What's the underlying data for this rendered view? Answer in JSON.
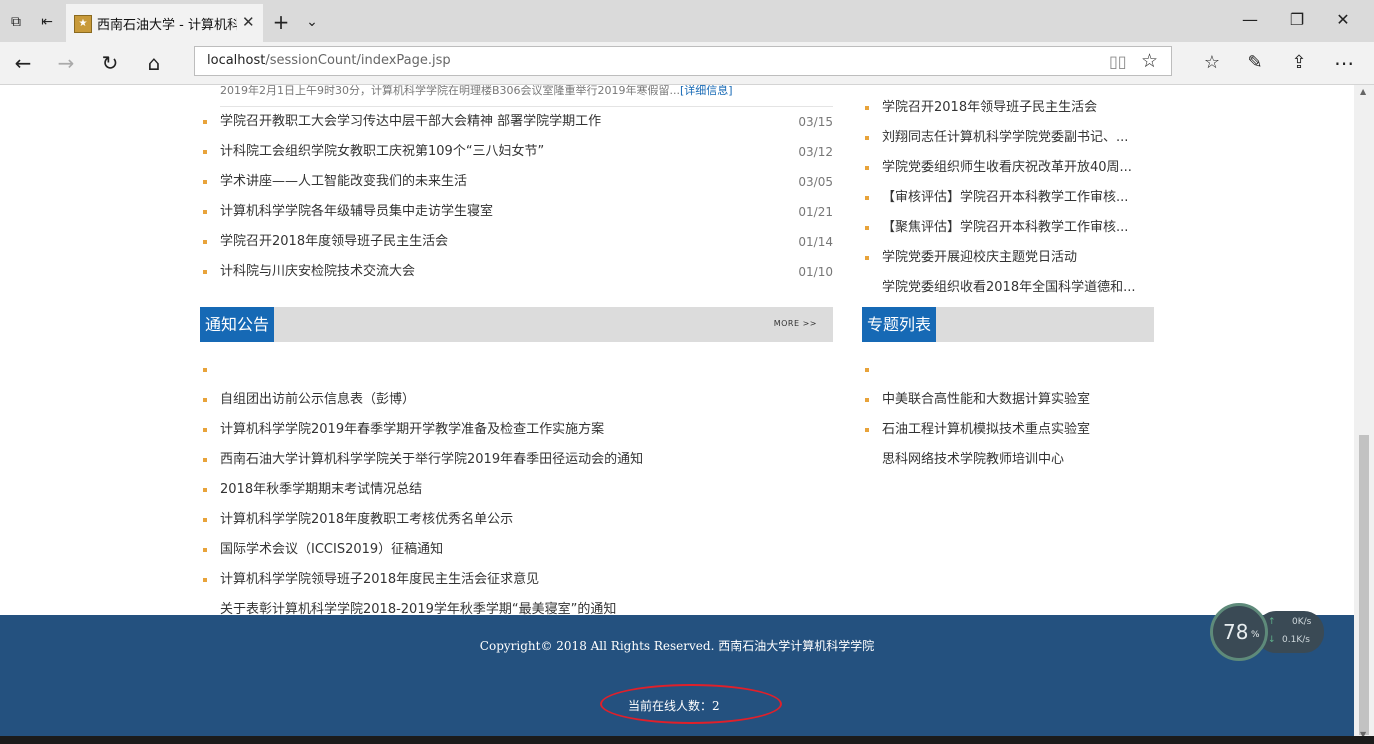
{
  "browser": {
    "tab_title": "西南石油大学 - 计算机科",
    "url_host": "localhost",
    "url_path": "/sessionCount/indexPage.jsp"
  },
  "news": {
    "summary": "2019年2月1日上午9时30分，计算机科学学院在明理楼B306会议室隆重举行2019年寒假留...",
    "summary_link": "[详细信息]",
    "items": [
      {
        "title": "学院召开教职工大会学习传达中层干部大会精神 部署学院学期工作",
        "date": "03/15"
      },
      {
        "title": "计科院工会组织学院女教职工庆祝第109个“三八妇女节”",
        "date": "03/12"
      },
      {
        "title": "学术讲座——人工智能改变我们的未来生活",
        "date": "03/05"
      },
      {
        "title": "计算机科学学院各年级辅导员集中走访学生寝室",
        "date": "01/21"
      },
      {
        "title": "学院召开2018年度领导班子民主生活会",
        "date": "01/14"
      },
      {
        "title": "计科院与川庆安检院技术交流大会",
        "date": "01/10"
      }
    ]
  },
  "right_news": {
    "items": [
      "学院召开2018年领导班子民主生活会",
      "刘翔同志任计算机科学学院党委副书记、...",
      "学院党委组织师生收看庆祝改革开放40周...",
      "【审核评估】学院召开本科教学工作审核...",
      "【聚焦评估】学院召开本科教学工作审核...",
      "学院党委开展迎校庆主题党日活动",
      "学院党委组织收看2018年全国科学道德和..."
    ]
  },
  "notices": {
    "heading": "通知公告",
    "more": "MORE >>",
    "items": [
      "",
      "自组团出访前公示信息表（彭博）",
      "计算机科学学院2019年春季学期开学教学准备及检查工作实施方案",
      "西南石油大学计算机科学学院关于举行学院2019年春季田径运动会的通知",
      "2018年秋季学期期末考试情况总结",
      "计算机科学学院2018年度教职工考核优秀名单公示",
      "国际学术会议（ICCIS2019）征稿通知",
      "计算机科学学院领导班子2018年度民主生活会征求意见",
      "关于表彰计算机科学学院2018-2019学年秋季学期“最美寝室”的通知"
    ]
  },
  "topics": {
    "heading": "专题列表",
    "items": [
      "",
      "中美联合高性能和大数据计算实验室",
      "石油工程计算机模拟技术重点实验室",
      "思科网络技术学院教师培训中心"
    ]
  },
  "footer": {
    "copyright": "Copyright© 2018 All Rights Reserved. 西南石油大学计算机科学学院",
    "online_count": "当前在线人数：2"
  },
  "widget": {
    "percent": "78",
    "percent_unit": "%",
    "up_speed": "0K/s",
    "down_speed": "0.1K/s"
  },
  "colors": {
    "accent": "#1669b5",
    "footer": "#24517f",
    "bullet": "#e8a33a",
    "highlight": "#e0202a"
  }
}
